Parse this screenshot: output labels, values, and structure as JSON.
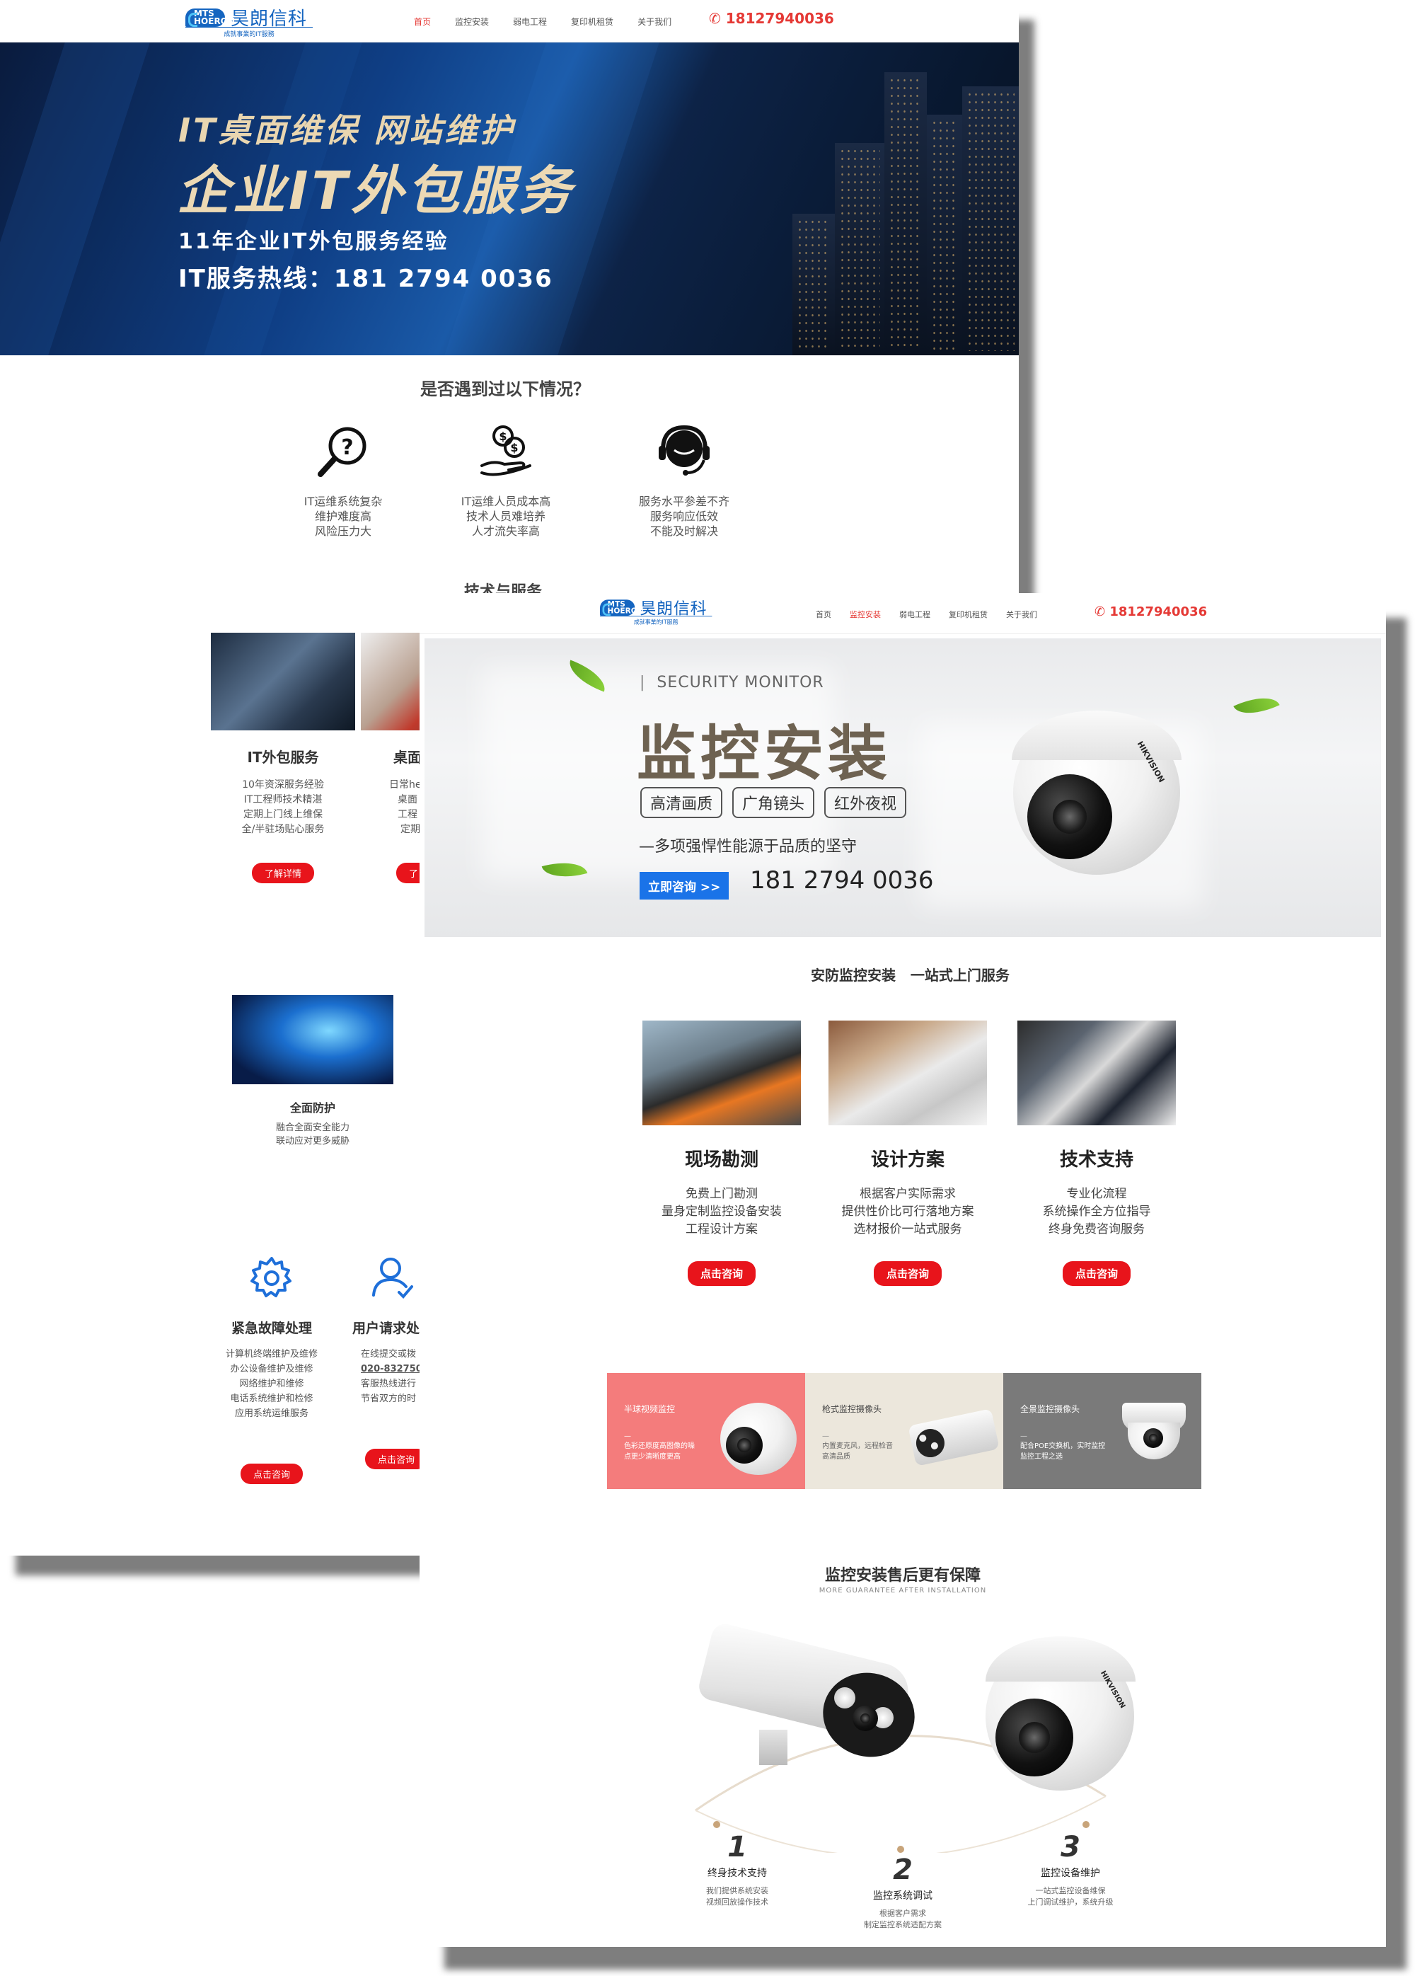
{
  "page1": {
    "logo": {
      "mark": "MTS HOERON",
      "name": "昊朗信科",
      "slogan": "成就事業的IT服務"
    },
    "nav": [
      "首页",
      "监控安装",
      "弱电工程",
      "复印机租赁",
      "关于我们"
    ],
    "phone": "18127940036",
    "banner": {
      "line1": "IT桌面维保  网站维护",
      "line2": "企业IT外包服务",
      "line3": "11年企业IT外包服务经验",
      "line4": "IT服务热线：181 2794 0036"
    },
    "problems_title": "是否遇到过以下情况？",
    "problems": [
      {
        "icon": "question-magnifier-icon",
        "lines": [
          "IT运维系统复杂",
          "维护难度高",
          "风险压力大"
        ]
      },
      {
        "icon": "coins-hand-icon",
        "lines": [
          "IT运维人员成本高",
          "技术人员难培养",
          "人才流失率高"
        ]
      },
      {
        "icon": "headset-support-icon",
        "lines": [
          "服务水平参差不齐",
          "服务响应低效",
          "不能及时解决"
        ]
      }
    ],
    "tech_title": "技术与服务",
    "cards": [
      {
        "title": "IT外包服务",
        "lines": [
          "10年资深服务经验",
          "IT工程师技术精湛",
          "定期上门线上维保",
          "全/半驻场贴心服务"
        ],
        "button": "了解详情"
      },
      {
        "title": "桌面",
        "lines": [
          "日常he",
          "桌面",
          "工程",
          "定期"
        ],
        "button": "了"
      }
    ],
    "protect": {
      "title": "全面防护",
      "lines": [
        "融合全面安全能力",
        "联动应对更多威胁"
      ]
    },
    "support": [
      {
        "icon": "gear-icon",
        "title": "紧急故障处理",
        "lines": [
          "计算机终端维护及维修",
          "办公设备维护及维修",
          "网络维护和维修",
          "电话系统维护和检修",
          "应用系统运维服务"
        ],
        "button": "点击咨询"
      },
      {
        "icon": "user-icon",
        "title": "用户请求处",
        "lines": [
          "在线提交或拨",
          "020-832750",
          "客服热线进行",
          "节省双方的时"
        ],
        "button": "点击咨询"
      }
    ]
  },
  "page2": {
    "logo": {
      "mark": "MTS HOERON",
      "name": "昊朗信科",
      "slogan": "成就事業的IT服務"
    },
    "nav": [
      "首页",
      "监控安装",
      "弱电工程",
      "复印机租赁",
      "关于我们"
    ],
    "phone": "18127940036",
    "banner": {
      "kicker": "SECURITY MONITOR",
      "title": "监控安装",
      "tags": [
        "高清画质",
        "广角镜头",
        "红外夜视"
      ],
      "subtitle": "—多项强悍性能源于品质的坚守",
      "cta": "立即咨询 >>",
      "phone": "181 2794 0036",
      "camera_brand": "HIKVISION"
    },
    "service_title": "安防监控安装   一站式上门服务",
    "services": [
      {
        "title": "现场勘测",
        "lines": [
          "免费上门勘测",
          "量身定制监控设备安装",
          "工程设计方案"
        ],
        "button": "点击咨询"
      },
      {
        "title": "设计方案",
        "lines": [
          "根据客户实际需求",
          "提供性价比可行落地方案",
          "选材报价一站式服务"
        ],
        "button": "点击咨询"
      },
      {
        "title": "技术支持",
        "lines": [
          "专业化流程",
          "系统操作全方位指导",
          "终身免费咨询服务"
        ],
        "button": "点击咨询"
      }
    ],
    "products": [
      {
        "title": "半球视频监控",
        "desc": [
          "色彩还原度高图像的噪",
          "点更少清晰度更高"
        ],
        "bg": "#f47c7c"
      },
      {
        "title": "枪式监控摄像头",
        "desc": [
          "内置麦克风，远程检音",
          "高清品质"
        ],
        "bg": "#ece7dc"
      },
      {
        "title": "全景监控摄像头",
        "desc": [
          "配合POE交换机，实时监控",
          "监控工程之选"
        ],
        "bg": "#7a7a7a"
      }
    ],
    "guarantee_title": "监控安装售后更有保障",
    "guarantee_sub": "MORE GUARANTEE AFTER INSTALLATION",
    "steps": [
      {
        "num": "1",
        "title": "终身技术支持",
        "lines": [
          "我们提供系统安装",
          "视频回放操作技术"
        ]
      },
      {
        "num": "2",
        "title": "监控系统调试",
        "lines": [
          "根据客户需求",
          "制定监控系统适配方案"
        ]
      },
      {
        "num": "3",
        "title": "监控设备维护",
        "lines": [
          "一站式监控设备维保",
          "上门调试维护，系统升级"
        ]
      }
    ]
  },
  "colors": {
    "brand_blue": "#1565c0",
    "accent_red": "#e8141b",
    "cta_blue": "#1a73e8",
    "gold_text": "#ecd9b4"
  }
}
